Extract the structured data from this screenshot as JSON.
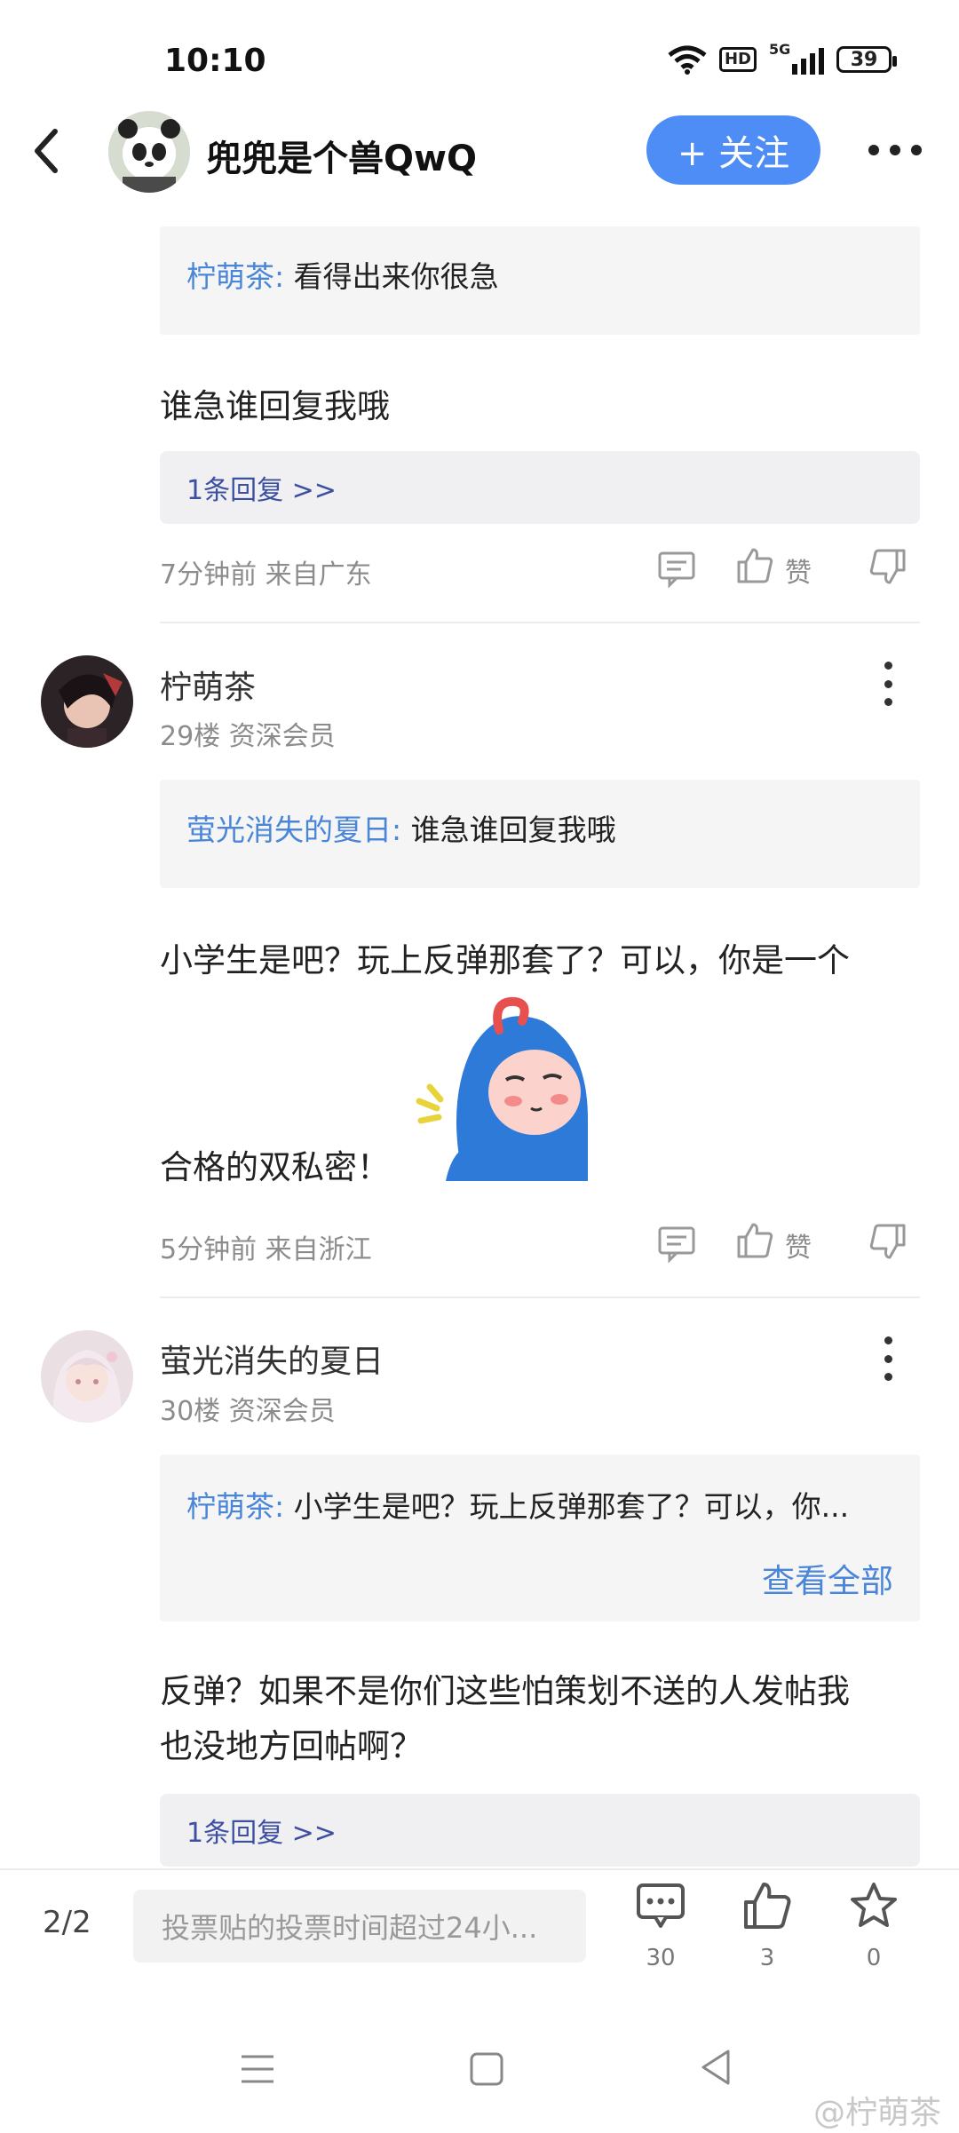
{
  "status_bar": {
    "time": "10:10",
    "hd": "HD",
    "signal": "5G",
    "battery": "39"
  },
  "header": {
    "title": "兜兜是个兽QwQ",
    "follow_label": "+ 关注"
  },
  "prev_comment": {
    "quote_author": "柠萌茶:",
    "quote_text": "看得出来你很急",
    "text": "谁急谁回复我哦",
    "reply_link": "1条回复 >>",
    "time": "7分钟前 来自广东",
    "like_label": "赞"
  },
  "comment_29": {
    "username": "柠萌茶",
    "sub": "29楼 资深会员",
    "quote_author": "萤光消失的夏日:",
    "quote_text": "谁急谁回复我哦",
    "text_line1": "小学生是吧？玩上反弹那套了？可以，你是一个",
    "text_line2": "合格的双私密！",
    "time": "5分钟前 来自浙江",
    "like_label": "赞"
  },
  "comment_30": {
    "username": "萤光消失的夏日",
    "sub": "30楼 资深会员",
    "quote_author": "柠萌茶:",
    "quote_text": "小学生是吧？玩上反弹那套了？可以，你...",
    "view_all": "查看全部",
    "text_line1": "反弹？如果不是你们这些怕策划不送的人发帖我",
    "text_line2": "也没地方回帖啊？",
    "reply_link": "1条回复 >>"
  },
  "bottom": {
    "page": "2/2",
    "input_placeholder": "投票贴的投票时间超过24小...",
    "comments_count": "30",
    "likes_count": "3",
    "favorites_count": "0"
  },
  "watermark": "@柠萌茶",
  "colors": {
    "accent": "#4e8cf6",
    "quote_name": "#4a86d8",
    "reply_link": "#3c4fa0"
  }
}
